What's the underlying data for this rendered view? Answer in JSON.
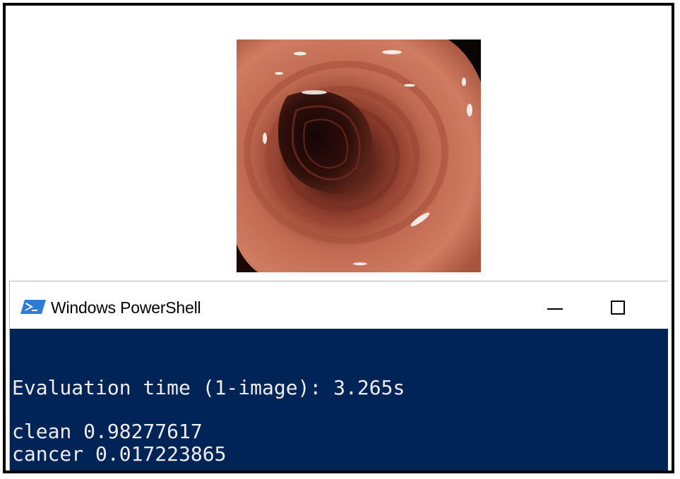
{
  "window": {
    "title": "Windows PowerShell",
    "minimize_label": "—",
    "maximize_label": "☐"
  },
  "image": {
    "subject": "colonoscopy-endoscopic-image"
  },
  "console": {
    "lines": [
      "Evaluation time (1-image): 3.265s",
      "clean 0.98277617",
      "cancer 0.017223865"
    ]
  },
  "colors": {
    "console_bg": "#012456",
    "console_text": "#eeedf0",
    "frame_border": "#000000",
    "tissue": "#c46e55"
  },
  "icons": [
    "powershell-icon",
    "minimize-icon",
    "maximize-icon"
  ]
}
